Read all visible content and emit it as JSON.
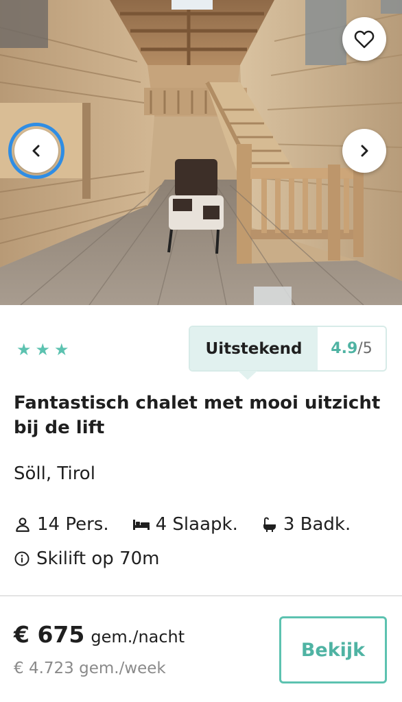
{
  "listing": {
    "star_count": 3,
    "rating": {
      "label": "Uitstekend",
      "score": "4.9",
      "max": "/5"
    },
    "title": "Fantastisch chalet met mooi uitzicht bij de lift",
    "location": "Söll, Tirol",
    "features": {
      "persons": "14 Pers.",
      "bedrooms": "4 Slaapk.",
      "bathrooms": "3 Badk."
    },
    "extra": "Skilift op 70m",
    "price": {
      "amount": "€ 675",
      "unit": "gem./nacht",
      "week": "€ 4.723 gem./week"
    },
    "view_button": "Bekijk"
  },
  "colors": {
    "accent": "#5cc2b0",
    "focus_ring": "#2f8de4",
    "rating_bg": "#e1f1ef"
  },
  "icons": {
    "favorite": "heart-icon",
    "prev": "chevron-left-icon",
    "next": "chevron-right-icon",
    "persons": "person-icon",
    "bedrooms": "bed-icon",
    "bathrooms": "bathtub-icon",
    "info": "info-icon",
    "star": "star-icon"
  }
}
